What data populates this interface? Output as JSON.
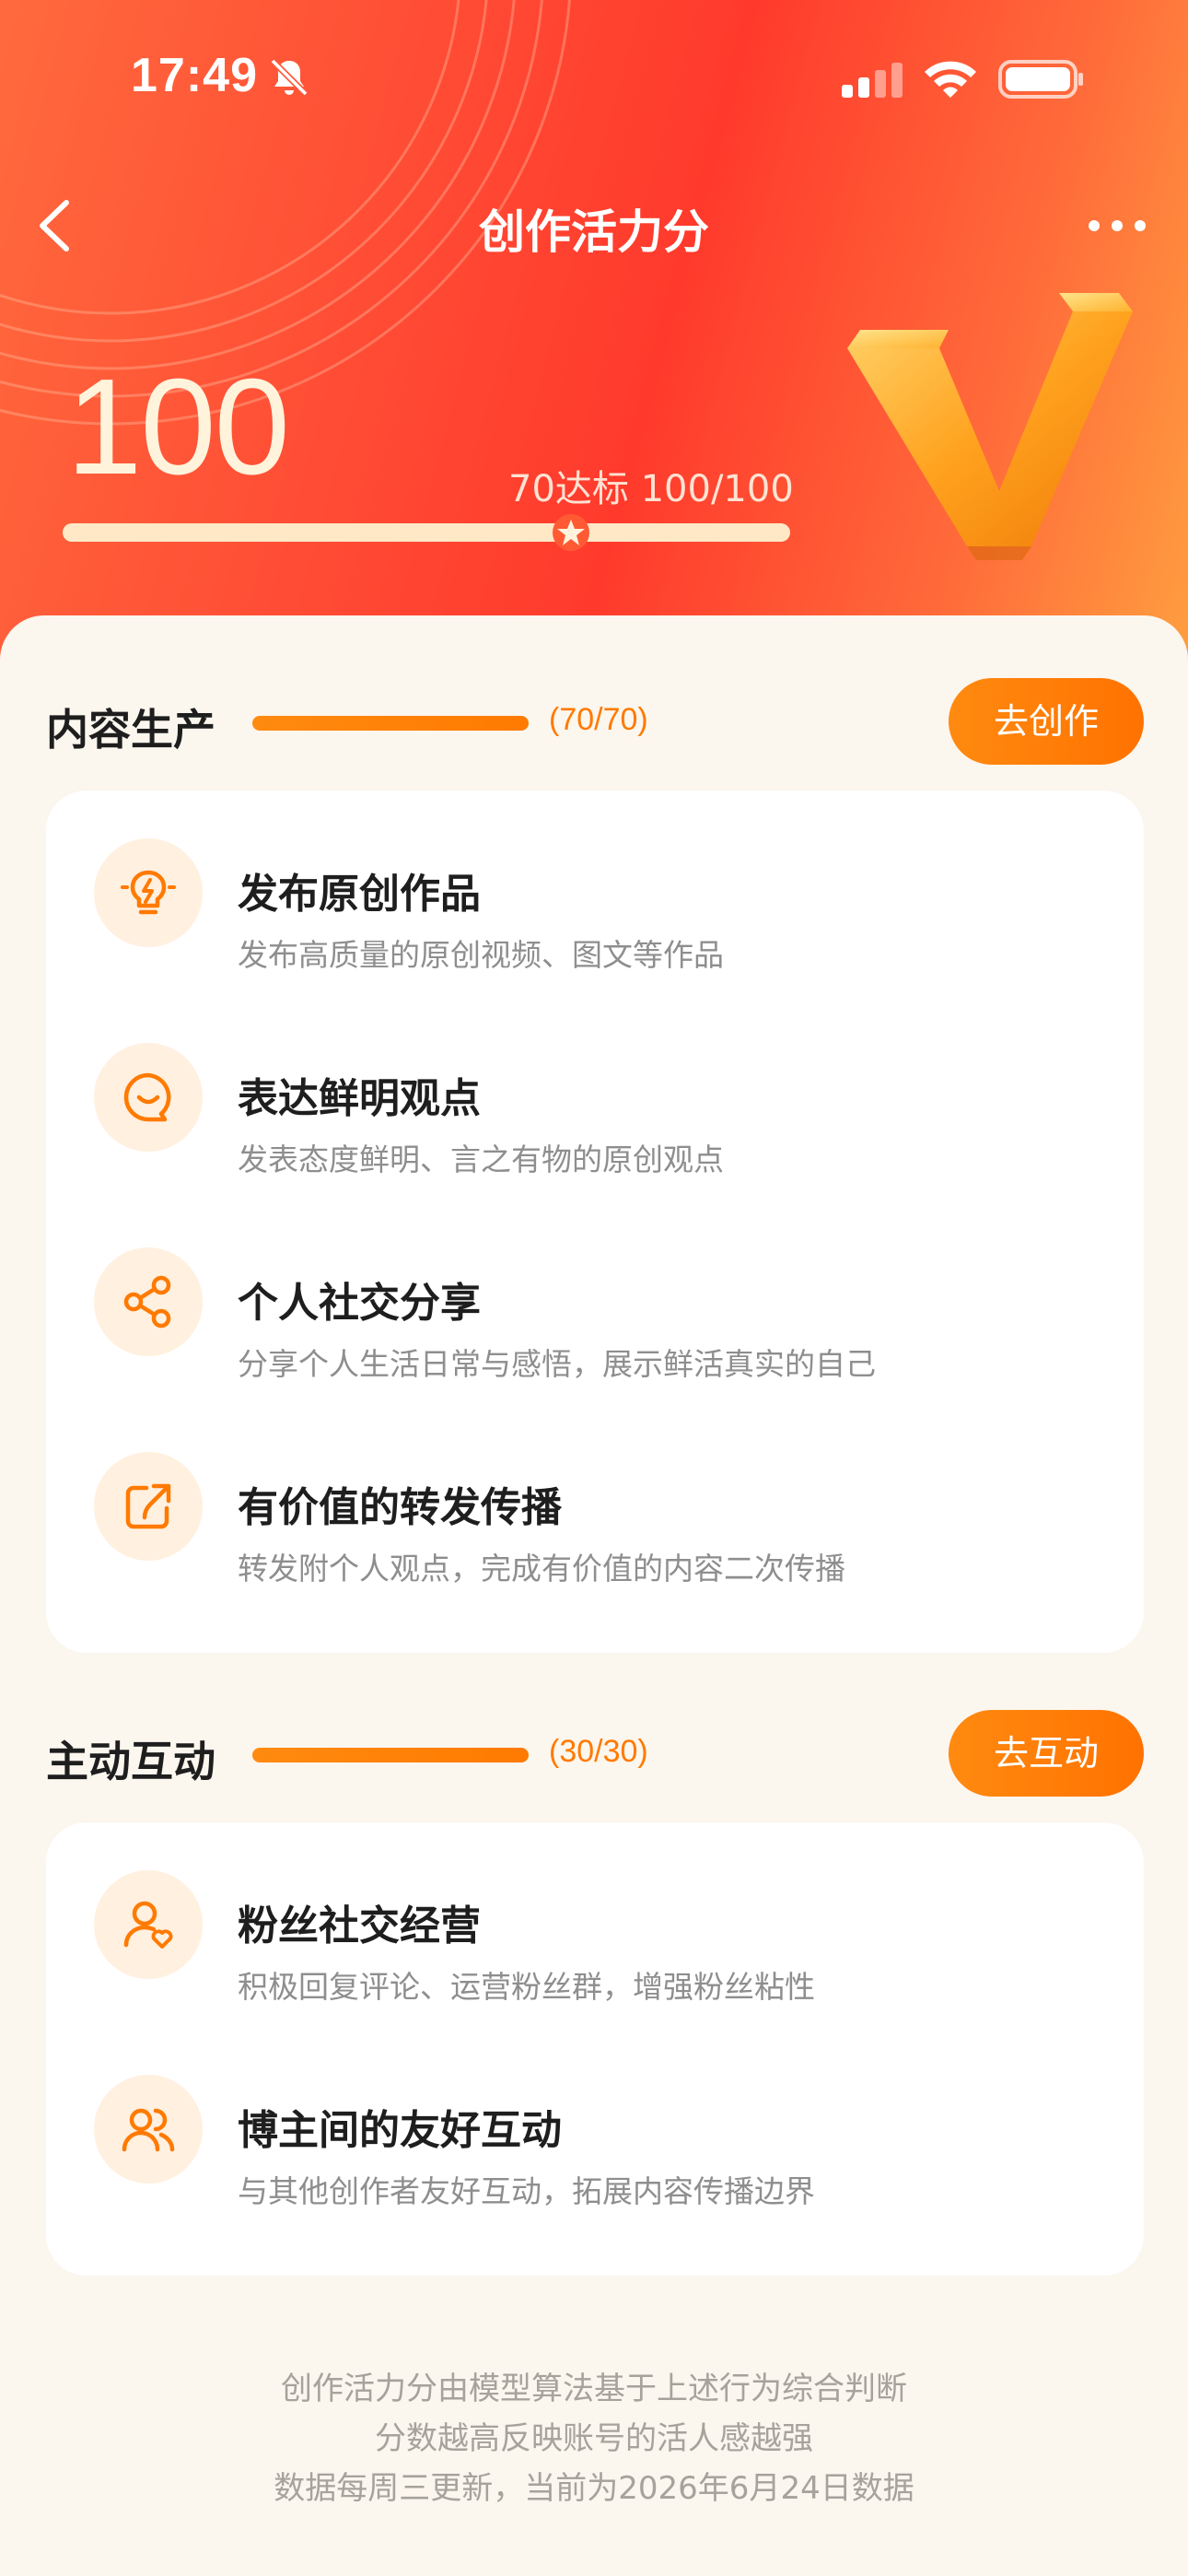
{
  "status_bar": {
    "time": "17:49"
  },
  "header": {
    "title": "创作活力分"
  },
  "score": {
    "value": "100",
    "target_label": "70达标 100/100"
  },
  "sections": [
    {
      "title": "内容生产",
      "count": "(70/70)",
      "progress": 1.0,
      "button": "去创作",
      "items": [
        {
          "title": "发布原创作品",
          "desc": "发布高质量的原创视频、图文等作品",
          "icon": "lightbulb-icon"
        },
        {
          "title": "表达鲜明观点",
          "desc": "发表态度鲜明、言之有物的原创观点",
          "icon": "smile-bubble-icon"
        },
        {
          "title": "个人社交分享",
          "desc": "分享个人生活日常与感悟，展示鲜活真实的自己",
          "icon": "share-icon"
        },
        {
          "title": "有价值的转发传播",
          "desc": "转发附个人观点，完成有价值的内容二次传播",
          "icon": "forward-icon"
        }
      ]
    },
    {
      "title": "主动互动",
      "count": "(30/30)",
      "progress": 1.0,
      "button": "去互动",
      "items": [
        {
          "title": "粉丝社交经营",
          "desc": "积极回复评论、运营粉丝群，增强粉丝粘性",
          "icon": "user-heart-icon"
        },
        {
          "title": "博主间的友好互动",
          "desc": "与其他创作者友好互动，拓展内容传播边界",
          "icon": "users-icon"
        }
      ]
    }
  ],
  "footer": {
    "lines": [
      "创作活力分由模型算法基于上述行为综合判断",
      "分数越高反映账号的活人感越强",
      "数据每周三更新，当前为2026年6月24日数据"
    ]
  },
  "colors": {
    "accent": "#FF7A00",
    "hero_red": "#FF3A2C",
    "sheet_bg": "#FBF6EE"
  }
}
